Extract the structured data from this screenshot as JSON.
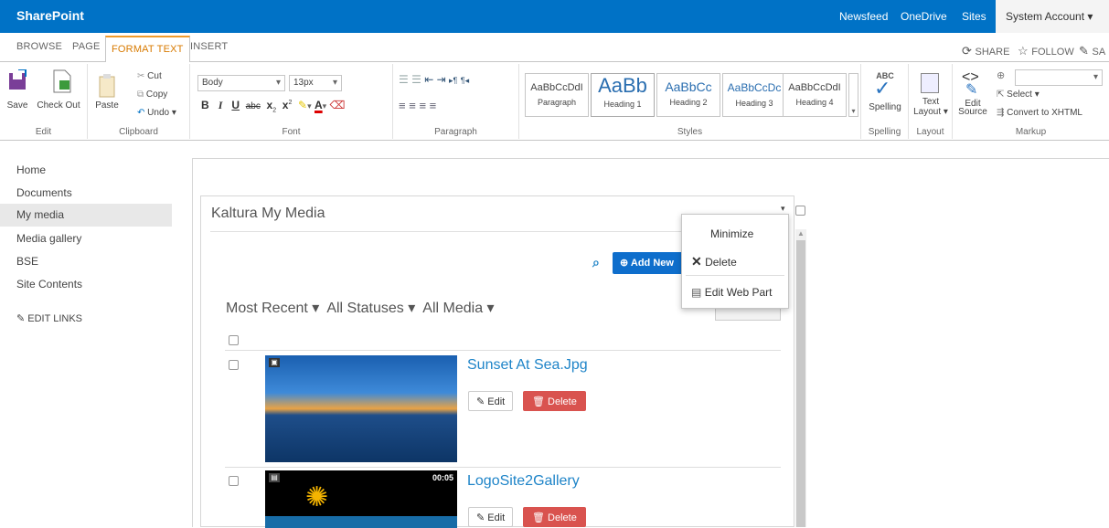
{
  "suite": {
    "brand": "SharePoint",
    "links": [
      "Newsfeed",
      "OneDrive",
      "Sites"
    ],
    "user": "System Account ▾"
  },
  "tabs": {
    "items": [
      "BROWSE",
      "PAGE",
      "FORMAT TEXT",
      "INSERT"
    ],
    "active": "FORMAT TEXT",
    "share": "SHARE",
    "follow": "FOLLOW",
    "save_short": "SA"
  },
  "ribbon": {
    "edit": {
      "save": "Save",
      "checkout": "Check Out",
      "group": "Edit"
    },
    "clipboard": {
      "paste": "Paste",
      "cut": "Cut",
      "copy": "Copy",
      "undo": "Undo ▾",
      "group": "Clipboard"
    },
    "font": {
      "family": "Body",
      "size": "13px",
      "group": "Font"
    },
    "paragraph": {
      "group": "Paragraph"
    },
    "styles": {
      "items": [
        {
          "sample": "AaBbCcDdI",
          "label": "Paragraph"
        },
        {
          "sample": "AaBb",
          "label": "Heading 1"
        },
        {
          "sample": "AaBbCc",
          "label": "Heading 2"
        },
        {
          "sample": "AaBbCcDc",
          "label": "Heading 3"
        },
        {
          "sample": "AaBbCcDdI",
          "label": "Heading 4"
        }
      ],
      "group": "Styles"
    },
    "spelling": {
      "label": "Spelling",
      "abc": "ABC",
      "group": "Spelling"
    },
    "layout": {
      "label1": "Text",
      "label2": "Layout ▾",
      "group": "Layout"
    },
    "markup": {
      "edit1": "Edit",
      "edit2": "Source",
      "select": "Select ▾",
      "convert": "Convert to XHTML",
      "group": "Markup"
    }
  },
  "nav": {
    "items": [
      "Home",
      "Documents",
      "My media",
      "Media gallery",
      "BSE",
      "Site Contents"
    ],
    "selected": "My media",
    "edit_links": "EDIT LINKS"
  },
  "webpart": {
    "title": "Kaltura My Media",
    "add_new": "Add New",
    "filters": [
      "Most Recent ▾",
      "All Statuses ▾",
      "All Media ▾"
    ],
    "items": [
      {
        "title": "Sunset At Sea.Jpg",
        "edit": "Edit",
        "delete": "Delete",
        "duration": ""
      },
      {
        "title": "LogoSite2Gallery",
        "edit": "Edit",
        "delete": "Delete",
        "duration": "00:05"
      }
    ]
  },
  "menu": {
    "items": [
      "Minimize",
      "Delete",
      "Edit Web Part"
    ]
  },
  "colors": {
    "suite": "#0072c6",
    "accent": "#f09b2c",
    "link": "#1e84c8",
    "danger": "#d9534f",
    "primary": "#0e6ecc"
  }
}
